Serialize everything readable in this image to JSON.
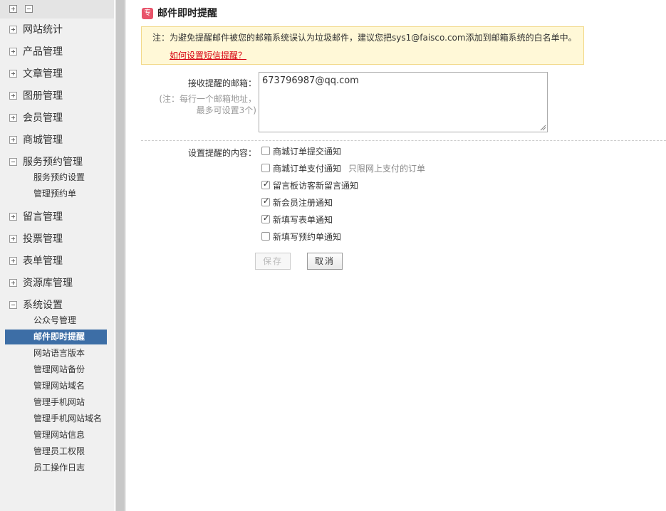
{
  "sidebar": {
    "groups": [
      {
        "label": "网站统计",
        "expanded": false
      },
      {
        "label": "产品管理",
        "expanded": false
      },
      {
        "label": "文章管理",
        "expanded": false
      },
      {
        "label": "图册管理",
        "expanded": false
      },
      {
        "label": "会员管理",
        "expanded": false
      },
      {
        "label": "商城管理",
        "expanded": false
      },
      {
        "label": "服务预约管理",
        "expanded": true,
        "items": [
          "服务预约设置",
          "管理预约单"
        ]
      },
      {
        "label": "留言管理",
        "expanded": false
      },
      {
        "label": "投票管理",
        "expanded": false
      },
      {
        "label": "表单管理",
        "expanded": false
      },
      {
        "label": "资源库管理",
        "expanded": false
      },
      {
        "label": "系统设置",
        "expanded": true,
        "items": [
          "公众号管理",
          "邮件即时提醒",
          "网站语言版本",
          "管理网站备份",
          "管理网站域名",
          "管理手机网站",
          "管理手机网站域名",
          "管理网站信息",
          "管理员工权限",
          "员工操作日志"
        ],
        "active_item": "邮件即时提醒"
      }
    ]
  },
  "page": {
    "title_icon_char": "专",
    "title": "邮件即时提醒",
    "notice_text": "注：为避免提醒邮件被您的邮箱系统误认为垃圾邮件，建议您把sys1@faisco.com添加到邮箱系统的白名单中。",
    "notice_link": "如何设置短信提醒？",
    "email_label": "接收提醒的邮箱：",
    "email_note_line1": "(注：每行一个邮箱地址，",
    "email_note_line2": "最多可设置3个)",
    "email_value": "673796987@qq.com",
    "content_label": "设置提醒的内容：",
    "options": [
      {
        "label": "商城订单提交通知",
        "checked": false,
        "hint": ""
      },
      {
        "label": "商城订单支付通知",
        "checked": false,
        "hint": "只限网上支付的订单"
      },
      {
        "label": "留言板访客新留言通知",
        "checked": true,
        "hint": ""
      },
      {
        "label": "新会员注册通知",
        "checked": true,
        "hint": ""
      },
      {
        "label": "新填写表单通知",
        "checked": true,
        "hint": ""
      },
      {
        "label": "新填写预约单通知",
        "checked": false,
        "hint": ""
      }
    ],
    "save_label": "保存",
    "cancel_label": "取消"
  },
  "colors": {
    "active_bg": "#3d6ea6",
    "notice_bg": "#fff8d7",
    "link": "#d6000f",
    "title_icon": "#e8536a"
  }
}
